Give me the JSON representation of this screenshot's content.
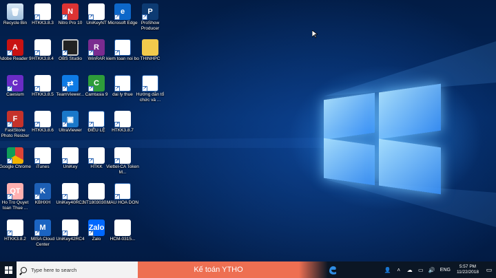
{
  "desktop": {
    "icons": [
      {
        "label": "Recycle Bin",
        "glyph": "🗑",
        "style": "i-recycle",
        "icon": "recycle-bin-icon",
        "col": 0,
        "row": 0,
        "shortcut": false
      },
      {
        "label": "HTKK3.8.3",
        "glyph": "HTKK",
        "style": "i-htkk",
        "icon": "htkk-icon",
        "col": 1,
        "row": 0,
        "shortcut": true
      },
      {
        "label": "Nitro Pro 10",
        "glyph": "N",
        "style": "i-nitro",
        "icon": "nitro-pro-icon",
        "col": 2,
        "row": 0,
        "shortcut": true
      },
      {
        "label": "UniKeyNT",
        "glyph": "U",
        "style": "i-unikey",
        "icon": "unikey-icon",
        "col": 3,
        "row": 0,
        "shortcut": true
      },
      {
        "label": "Microsoft Edge",
        "glyph": "e",
        "style": "i-edge",
        "icon": "edge-icon",
        "col": 4,
        "row": 0,
        "shortcut": true
      },
      {
        "label": "ProShow Producer",
        "glyph": "P",
        "style": "i-proshow",
        "icon": "proshow-icon",
        "col": 5,
        "row": 0,
        "shortcut": true
      },
      {
        "label": "Adobe Reader 9",
        "glyph": "A",
        "style": "i-adobe",
        "icon": "adobe-reader-icon",
        "col": 0,
        "row": 1,
        "shortcut": true
      },
      {
        "label": "HTKK3.8.4",
        "glyph": "HTKK",
        "style": "i-htkk",
        "icon": "htkk-icon",
        "col": 1,
        "row": 1,
        "shortcut": true
      },
      {
        "label": "OBS Studio",
        "glyph": "",
        "style": "i-obs",
        "icon": "obs-studio-icon",
        "col": 2,
        "row": 1,
        "shortcut": true
      },
      {
        "label": "WinRAR",
        "glyph": "R",
        "style": "i-winrar",
        "icon": "winrar-icon",
        "col": 3,
        "row": 1,
        "shortcut": true
      },
      {
        "label": "kiem toan noi bo",
        "glyph": "W",
        "style": "i-word",
        "icon": "word-document-icon",
        "col": 4,
        "row": 1,
        "shortcut": true
      },
      {
        "label": "THINHPC",
        "glyph": "",
        "style": "i-folder",
        "icon": "folder-icon",
        "col": 5,
        "row": 1,
        "shortcut": false
      },
      {
        "label": "Caesium",
        "glyph": "C",
        "style": "i-caesium",
        "icon": "caesium-icon",
        "col": 0,
        "row": 2,
        "shortcut": true
      },
      {
        "label": "HTKK3.8.5",
        "glyph": "HTKK",
        "style": "i-htkk",
        "icon": "htkk-icon",
        "col": 1,
        "row": 2,
        "shortcut": true
      },
      {
        "label": "TeamViewer...",
        "glyph": "⇄",
        "style": "i-teamviewer",
        "icon": "teamviewer-icon",
        "col": 2,
        "row": 2,
        "shortcut": true
      },
      {
        "label": "Camtasia 9",
        "glyph": "C",
        "style": "i-camtasia",
        "icon": "camtasia-icon",
        "col": 3,
        "row": 2,
        "shortcut": true
      },
      {
        "label": "dai ly thue",
        "glyph": "W",
        "style": "i-word",
        "icon": "word-document-icon",
        "col": 4,
        "row": 2,
        "shortcut": true
      },
      {
        "label": "Hướng dẫn tổ chức và ...",
        "glyph": "W",
        "style": "i-word",
        "icon": "word-document-icon",
        "col": 5,
        "row": 2,
        "shortcut": true
      },
      {
        "label": "FastStone Photo Resizer",
        "glyph": "F",
        "style": "i-faststone",
        "icon": "faststone-icon",
        "col": 0,
        "row": 3,
        "shortcut": true
      },
      {
        "label": "HTKK3.8.6",
        "glyph": "HTKK",
        "style": "i-htkk",
        "icon": "htkk-icon",
        "col": 1,
        "row": 3,
        "shortcut": true
      },
      {
        "label": "UltraViewer",
        "glyph": "▣",
        "style": "i-ultraviewer",
        "icon": "ultraviewer-icon",
        "col": 2,
        "row": 3,
        "shortcut": true
      },
      {
        "label": "ĐIỀU LỆ",
        "glyph": "W",
        "style": "i-word",
        "icon": "word-document-icon",
        "col": 3,
        "row": 3,
        "shortcut": true
      },
      {
        "label": "HTKK3.8.7",
        "glyph": "HTKK",
        "style": "i-htkk",
        "icon": "htkk-icon",
        "col": 4,
        "row": 3,
        "shortcut": true
      },
      {
        "label": "Google Chrome",
        "glyph": "",
        "style": "i-chrome",
        "icon": "chrome-icon",
        "col": 0,
        "row": 4,
        "shortcut": true
      },
      {
        "label": "iTunes",
        "glyph": "♪",
        "style": "i-itunes",
        "icon": "itunes-icon",
        "col": 1,
        "row": 4,
        "shortcut": true
      },
      {
        "label": "UniKey",
        "glyph": "U",
        "style": "i-unikey",
        "icon": "unikey-icon",
        "col": 2,
        "row": 4,
        "shortcut": true
      },
      {
        "label": "HTKK",
        "glyph": "HTKK",
        "style": "i-htkk",
        "icon": "htkk-icon",
        "col": 3,
        "row": 4,
        "shortcut": true
      },
      {
        "label": "Viettel-CA Token M...",
        "glyph": "viettel",
        "style": "i-viettel",
        "icon": "viettel-ca-icon",
        "col": 4,
        "row": 4,
        "shortcut": true
      },
      {
        "label": "Ho Tro Quyet toan Thue ...",
        "glyph": "QT",
        "style": "i-hotro",
        "icon": "ho-tro-quyet-toan-icon",
        "col": 0,
        "row": 5,
        "shortcut": true
      },
      {
        "label": "KBHXH",
        "glyph": "K",
        "style": "i-kbhxh",
        "icon": "kbhxh-icon",
        "col": 1,
        "row": 5,
        "shortcut": true
      },
      {
        "label": "UniKey40RC2",
        "glyph": "U",
        "style": "i-unikey",
        "icon": "unikey-icon",
        "col": 2,
        "row": 5,
        "shortcut": true
      },
      {
        "label": "NT1803030...",
        "glyph": "pdf",
        "style": "i-pdf",
        "icon": "pdf-file-icon",
        "col": 3,
        "row": 5,
        "shortcut": false
      },
      {
        "label": "MAU HOA DON",
        "glyph": "W",
        "style": "i-word",
        "icon": "word-document-icon",
        "col": 4,
        "row": 5,
        "shortcut": true
      },
      {
        "label": "HTKK3.8.2",
        "glyph": "HTKK",
        "style": "i-htkk",
        "icon": "htkk-icon",
        "col": 0,
        "row": 6,
        "shortcut": true
      },
      {
        "label": "MISA Cloud Center",
        "glyph": "M",
        "style": "i-misa",
        "icon": "misa-icon",
        "col": 1,
        "row": 6,
        "shortcut": true
      },
      {
        "label": "UniKey42RC4",
        "glyph": "U",
        "style": "i-unikey",
        "icon": "unikey-icon",
        "col": 2,
        "row": 6,
        "shortcut": true
      },
      {
        "label": "Zalo",
        "glyph": "Zalo",
        "style": "i-zalo",
        "icon": "zalo-icon",
        "col": 3,
        "row": 6,
        "shortcut": true
      },
      {
        "label": "HCM-0315...",
        "glyph": "",
        "style": "i-file",
        "icon": "blank-file-icon",
        "col": 4,
        "row": 6,
        "shortcut": false
      }
    ]
  },
  "taskbar": {
    "search_placeholder": "Type here to search",
    "banner_text": "Kế toán YTHO",
    "language": "ENG",
    "time": "5:57 PM",
    "date": "11/22/2018"
  },
  "colors": {
    "banner": "#ee6f52",
    "taskbar": "#0b1624",
    "wallpaper": "#03275e"
  }
}
